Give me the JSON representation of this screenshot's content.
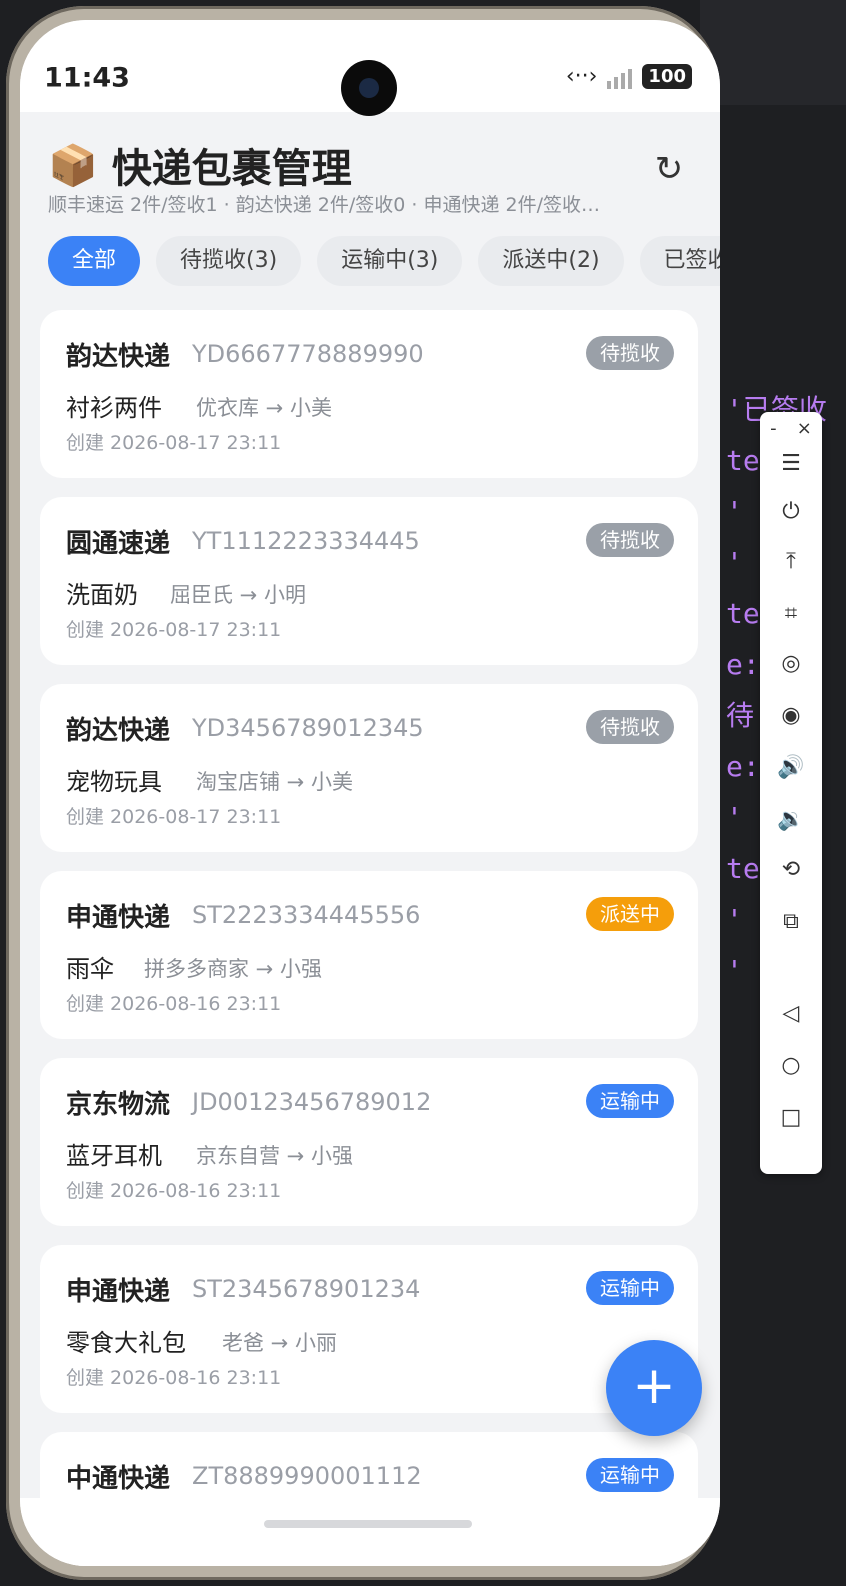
{
  "status_bar": {
    "time": "11:43",
    "battery": "100"
  },
  "app": {
    "title_icon": "📦",
    "title": "快递包裹管理",
    "summary": "顺丰速运 2件/签收1 · 韵达快递 2件/签收0 · 申通快递 2件/签收…",
    "refresh_icon": "refresh-icon"
  },
  "tabs": [
    {
      "label": "全部",
      "active": true
    },
    {
      "label": "待揽收(3)",
      "active": false
    },
    {
      "label": "运输中(3)",
      "active": false
    },
    {
      "label": "派送中(2)",
      "active": false
    },
    {
      "label": "已签收",
      "active": false
    }
  ],
  "packages": [
    {
      "company": "韵达快递",
      "tracking": "YD6667778889990",
      "status": "待揽收",
      "status_color": "#9aa0a8",
      "item": "衬衫两件",
      "route": "优衣库 → 小美",
      "created": "创建 2026-08-17 23:11"
    },
    {
      "company": "圆通速递",
      "tracking": "YT1112223334445",
      "status": "待揽收",
      "status_color": "#9aa0a8",
      "item": "洗面奶",
      "route": "屈臣氏 → 小明",
      "created": "创建 2026-08-17 23:11"
    },
    {
      "company": "韵达快递",
      "tracking": "YD3456789012345",
      "status": "待揽收",
      "status_color": "#9aa0a8",
      "item": "宠物玩具",
      "route": "淘宝店铺 → 小美",
      "created": "创建 2026-08-17 23:11"
    },
    {
      "company": "申通快递",
      "tracking": "ST2223334445556",
      "status": "派送中",
      "status_color": "#f59e0b",
      "item": "雨伞",
      "route": "拼多多商家 → 小强",
      "created": "创建 2026-08-16 23:11"
    },
    {
      "company": "京东物流",
      "tracking": "JD00123456789012",
      "status": "运输中",
      "status_color": "#3b82f6",
      "item": "蓝牙耳机",
      "route": "京东自营 → 小强",
      "created": "创建 2026-08-16 23:11"
    },
    {
      "company": "申通快递",
      "tracking": "ST2345678901234",
      "status": "运输中",
      "status_color": "#3b82f6",
      "item": "零食大礼包",
      "route": "老爸 → 小丽",
      "created": "创建 2026-08-16 23:11"
    },
    {
      "company": "中通快递",
      "tracking": "ZT8889990001112",
      "status": "运输中",
      "status_color": "#3b82f6",
      "item": "",
      "route": "",
      "created": ""
    }
  ],
  "fab": {
    "label": "+"
  },
  "colors": {
    "accent": "#3b82f6",
    "pending": "#9aa0a8",
    "delivering": "#f59e0b"
  },
  "toolbar": {
    "minimize": "-",
    "close": "×",
    "icons": [
      "menu-icon",
      "power-icon",
      "pin-top-icon",
      "crop-icon",
      "screen-record-icon",
      "screenshot-icon",
      "volume-up-icon",
      "volume-down-icon",
      "rotate-icon",
      "multi-device-icon",
      "back-icon",
      "home-icon",
      "recents-icon"
    ]
  },
  "background_code": [
    "'已签收",
    "te 已",
    "'  中",
    "'  中",
    "te 运",
    "e: 揽",
    "待   ,",
    "e: 常",
    "'  中",
    "te 已",
    "'  中",
    "'  收"
  ]
}
